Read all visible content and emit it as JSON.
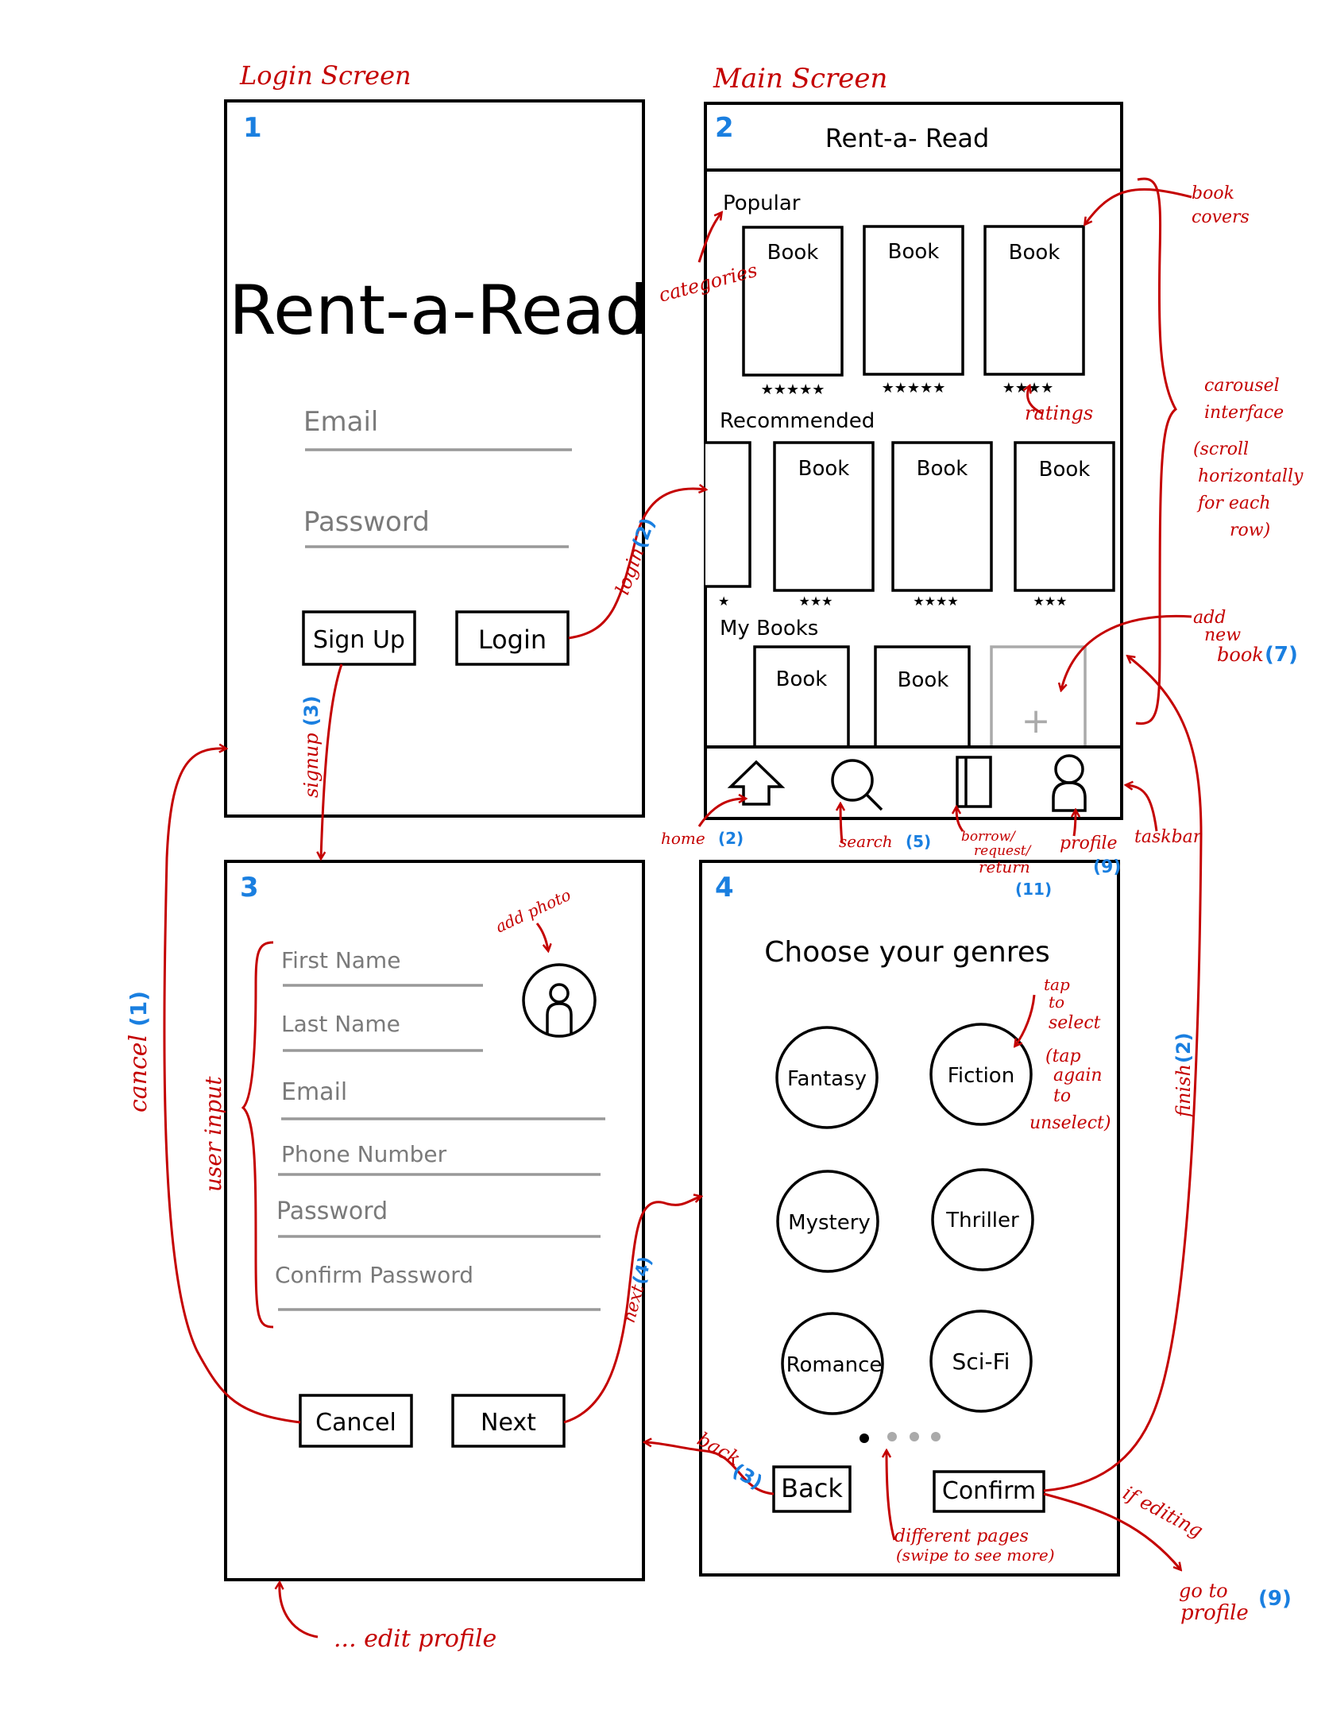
{
  "screen_titles": {
    "login": "Login Screen",
    "main": "Main Screen"
  },
  "screen_numbers": {
    "s1": "1",
    "s2": "2",
    "s3": "3",
    "s4": "4"
  },
  "login": {
    "app_title": "Rent-a-Read",
    "email": "Email",
    "password": "Password",
    "signup_label": "Sign Up",
    "login_label": "Login"
  },
  "main": {
    "header_title": "Rent-a- Read",
    "popular_label": "Popular",
    "recommended_label": "Recommended",
    "mybooks_label": "My Books",
    "book_label": "Book",
    "popular_ratings": [
      "★★★★★",
      "★★★★★",
      "★★★★"
    ],
    "recommended_ratings": [
      "★",
      "★★★",
      "★★★★",
      "★★★"
    ],
    "add_book_symbol": "+"
  },
  "signup": {
    "first_name": "First Name",
    "last_name": "Last Name",
    "email": "Email",
    "phone": "Phone  Number",
    "password": "Password",
    "confirm_password": "Confirm  Password",
    "cancel_label": "Cancel",
    "next_label": "Next"
  },
  "genres": {
    "title": "Choose your genres",
    "items": [
      "Fantasy",
      "Fiction",
      "Mystery",
      "Thriller",
      "Romance",
      "Sci-Fi"
    ],
    "back_label": "Back",
    "confirm_label": "Confirm"
  },
  "annotations": {
    "login_arrow": "login",
    "login_num": "(2)",
    "signup_arrow": "signup",
    "signup_num": "(3)",
    "cancel_arrow": "cancel",
    "cancel_num": "(1)",
    "user_input": "user input",
    "add_photo": "add photo",
    "next_arrow": "next",
    "next_num": "(4)",
    "categories": "categories",
    "book_covers_1": "book",
    "book_covers_2": "covers",
    "ratings": "ratings",
    "carousel_1": "carousel",
    "carousel_2": "interface",
    "carousel_3": "(scroll",
    "carousel_4": "horizontally",
    "carousel_5": "for each",
    "carousel_6": "row)",
    "add_new_1": "add",
    "add_new_2": "new",
    "add_new_3": "book",
    "add_new_num": "(7)",
    "home": "home",
    "home_num": "(2)",
    "search": "search",
    "search_num": "(5)",
    "borrow_1": "borrow/",
    "borrow_2": "request/",
    "borrow_3": "return",
    "borrow_num": "(11)",
    "profile": "profile",
    "profile_num": "(9)",
    "taskbar": "taskbar",
    "finish": "finish",
    "finish_num": "(2)",
    "tap_1": "tap",
    "tap_2": "to",
    "tap_3": "select",
    "tap_4": "(tap",
    "tap_5": "again",
    "tap_6": "to",
    "tap_7": "unselect)",
    "back_arrow": "back",
    "back_num": "(3)",
    "pages_1": "different  pages",
    "pages_2": "(swipe to see more)",
    "if_editing": "if editing",
    "goto_1": "go to",
    "goto_2": "profile",
    "goto_num": "(9)",
    "edit_profile": "... edit  profile"
  }
}
